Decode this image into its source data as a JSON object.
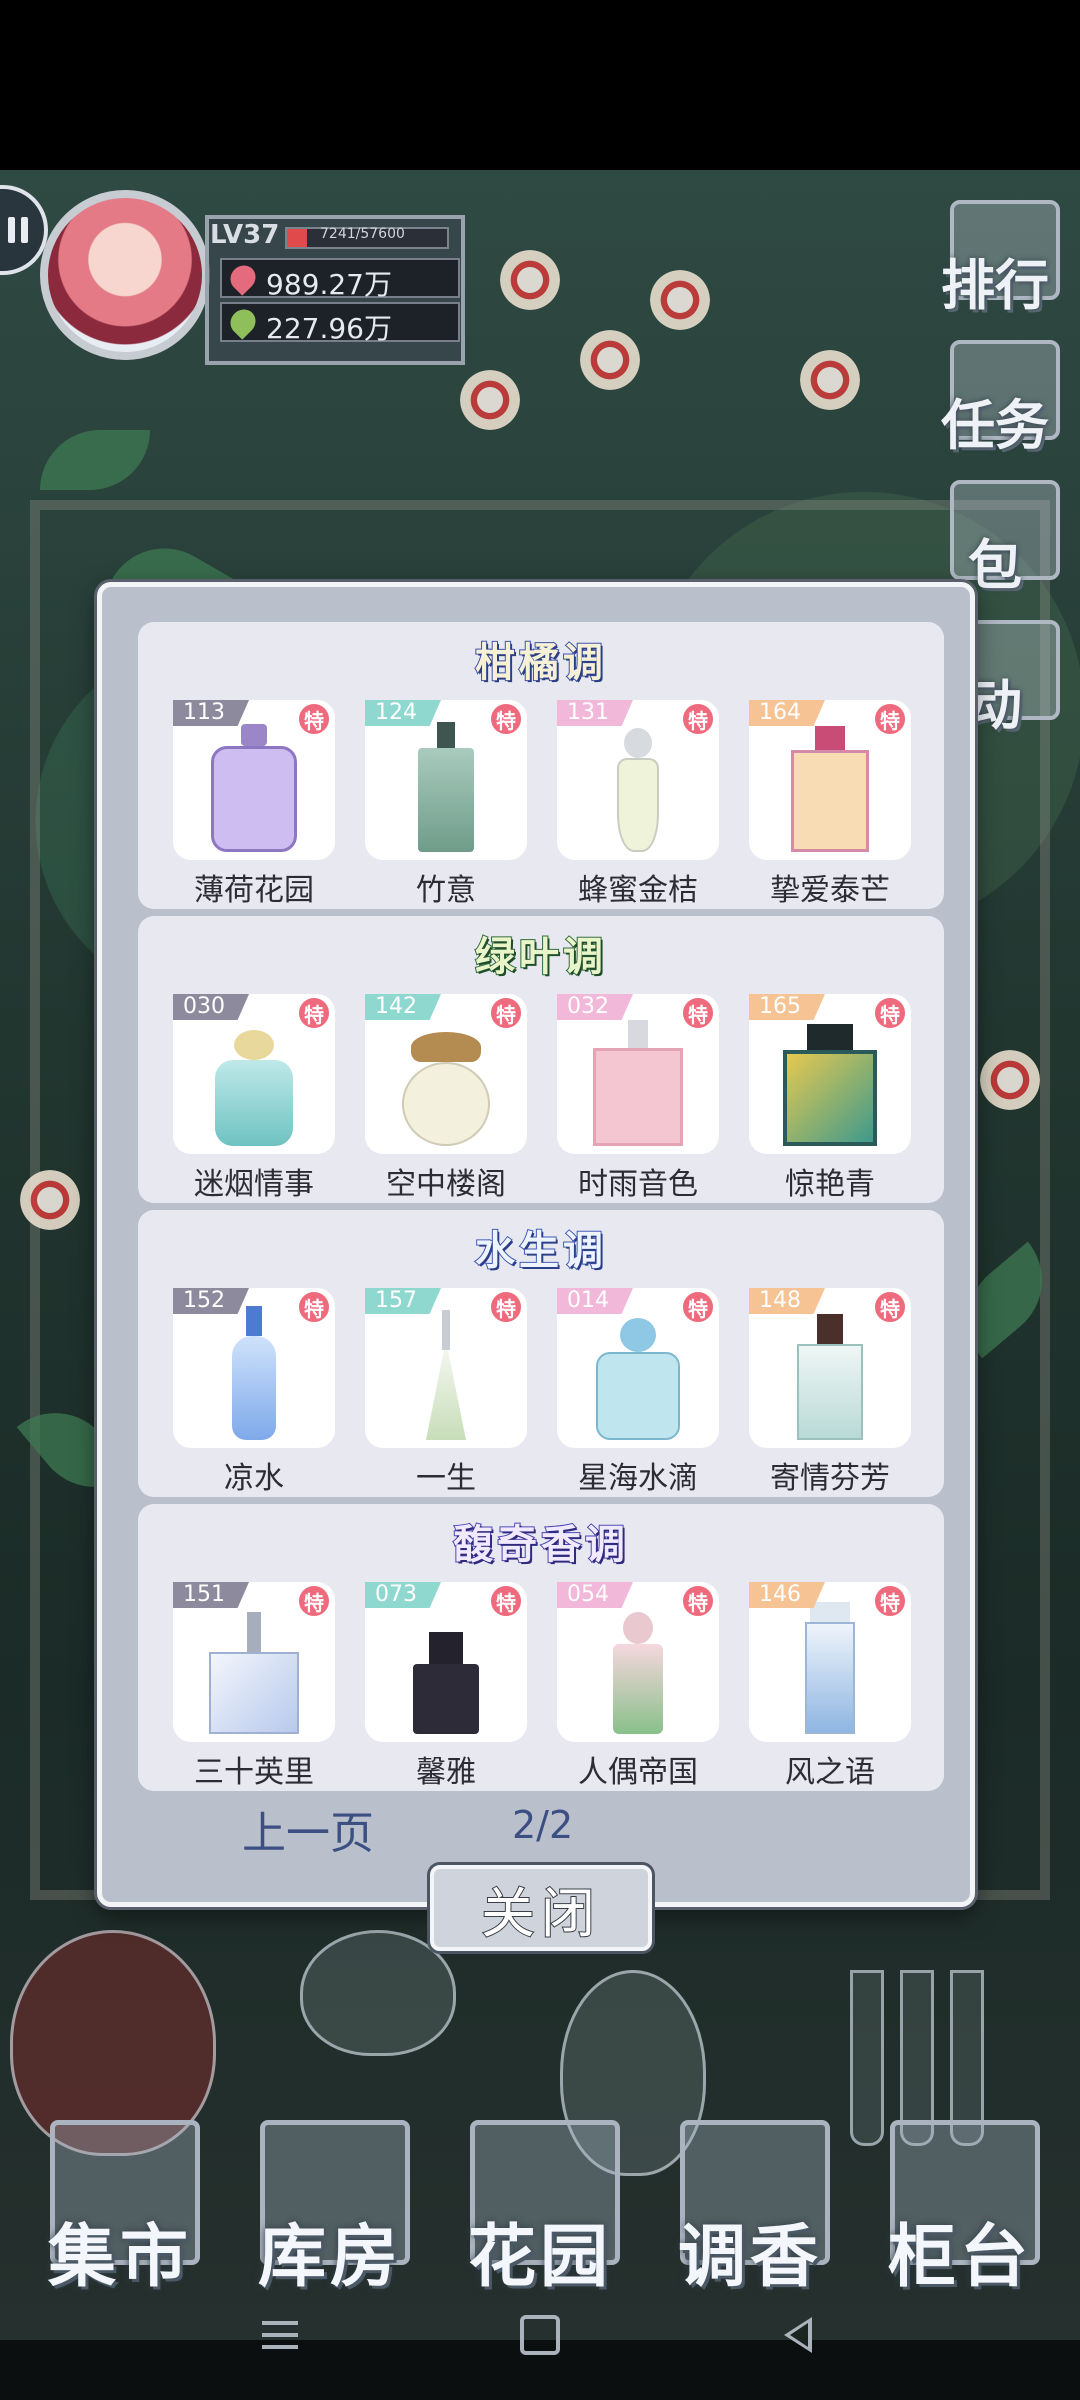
{
  "profile": {
    "level": "LV37",
    "exp": "7241/57600",
    "exp_fraction": 0.126,
    "hearts": "989.27万",
    "leaves": "227.96万"
  },
  "side_menu": [
    {
      "label": "排行",
      "icon": "ranking-icon"
    },
    {
      "label": "任务",
      "icon": "task-icon"
    },
    {
      "label": "包",
      "icon": "bag-icon"
    },
    {
      "label": "动",
      "icon": "event-icon"
    }
  ],
  "dialog": {
    "sections": [
      {
        "title": "柑橘调",
        "items": [
          {
            "num": "113",
            "badge": "特",
            "name": "薄荷花园",
            "num_color": "purple"
          },
          {
            "num": "124",
            "badge": "特",
            "name": "竹意",
            "num_color": "teal"
          },
          {
            "num": "131",
            "badge": "特",
            "name": "蜂蜜金桔",
            "num_color": "pink"
          },
          {
            "num": "164",
            "badge": "特",
            "name": "挚爱泰芒",
            "num_color": "orange"
          }
        ]
      },
      {
        "title": "绿叶调",
        "items": [
          {
            "num": "030",
            "badge": "特",
            "name": "迷烟情事",
            "num_color": "purple"
          },
          {
            "num": "142",
            "badge": "特",
            "name": "空中楼阁",
            "num_color": "teal"
          },
          {
            "num": "032",
            "badge": "特",
            "name": "时雨音色",
            "num_color": "pink"
          },
          {
            "num": "165",
            "badge": "特",
            "name": "惊艳青",
            "num_color": "orange"
          }
        ]
      },
      {
        "title": "水生调",
        "items": [
          {
            "num": "152",
            "badge": "特",
            "name": "凉水",
            "num_color": "purple"
          },
          {
            "num": "157",
            "badge": "特",
            "name": "一生",
            "num_color": "teal"
          },
          {
            "num": "014",
            "badge": "特",
            "name": "星海水滴",
            "num_color": "pink"
          },
          {
            "num": "148",
            "badge": "特",
            "name": "寄情芬芳",
            "num_color": "orange"
          }
        ]
      },
      {
        "title": "馥奇香调",
        "items": [
          {
            "num": "151",
            "badge": "特",
            "name": "三十英里",
            "num_color": "purple"
          },
          {
            "num": "073",
            "badge": "特",
            "name": "馨雅",
            "num_color": "teal"
          },
          {
            "num": "054",
            "badge": "特",
            "name": "人偶帝国",
            "num_color": "pink"
          },
          {
            "num": "146",
            "badge": "特",
            "name": "风之语",
            "num_color": "orange"
          }
        ]
      }
    ],
    "prev_label": "上一页",
    "page": "2/2",
    "close_label": "关闭"
  },
  "bottom_nav": [
    {
      "label": "集市"
    },
    {
      "label": "库房"
    },
    {
      "label": "花园"
    },
    {
      "label": "调香"
    },
    {
      "label": "柜台"
    }
  ],
  "colors": {
    "badge": "#ee6a7d",
    "dialog_bg": "#b9bfcb",
    "section_bg": "#e8e9f0",
    "pager_text": "#3b4f83"
  }
}
